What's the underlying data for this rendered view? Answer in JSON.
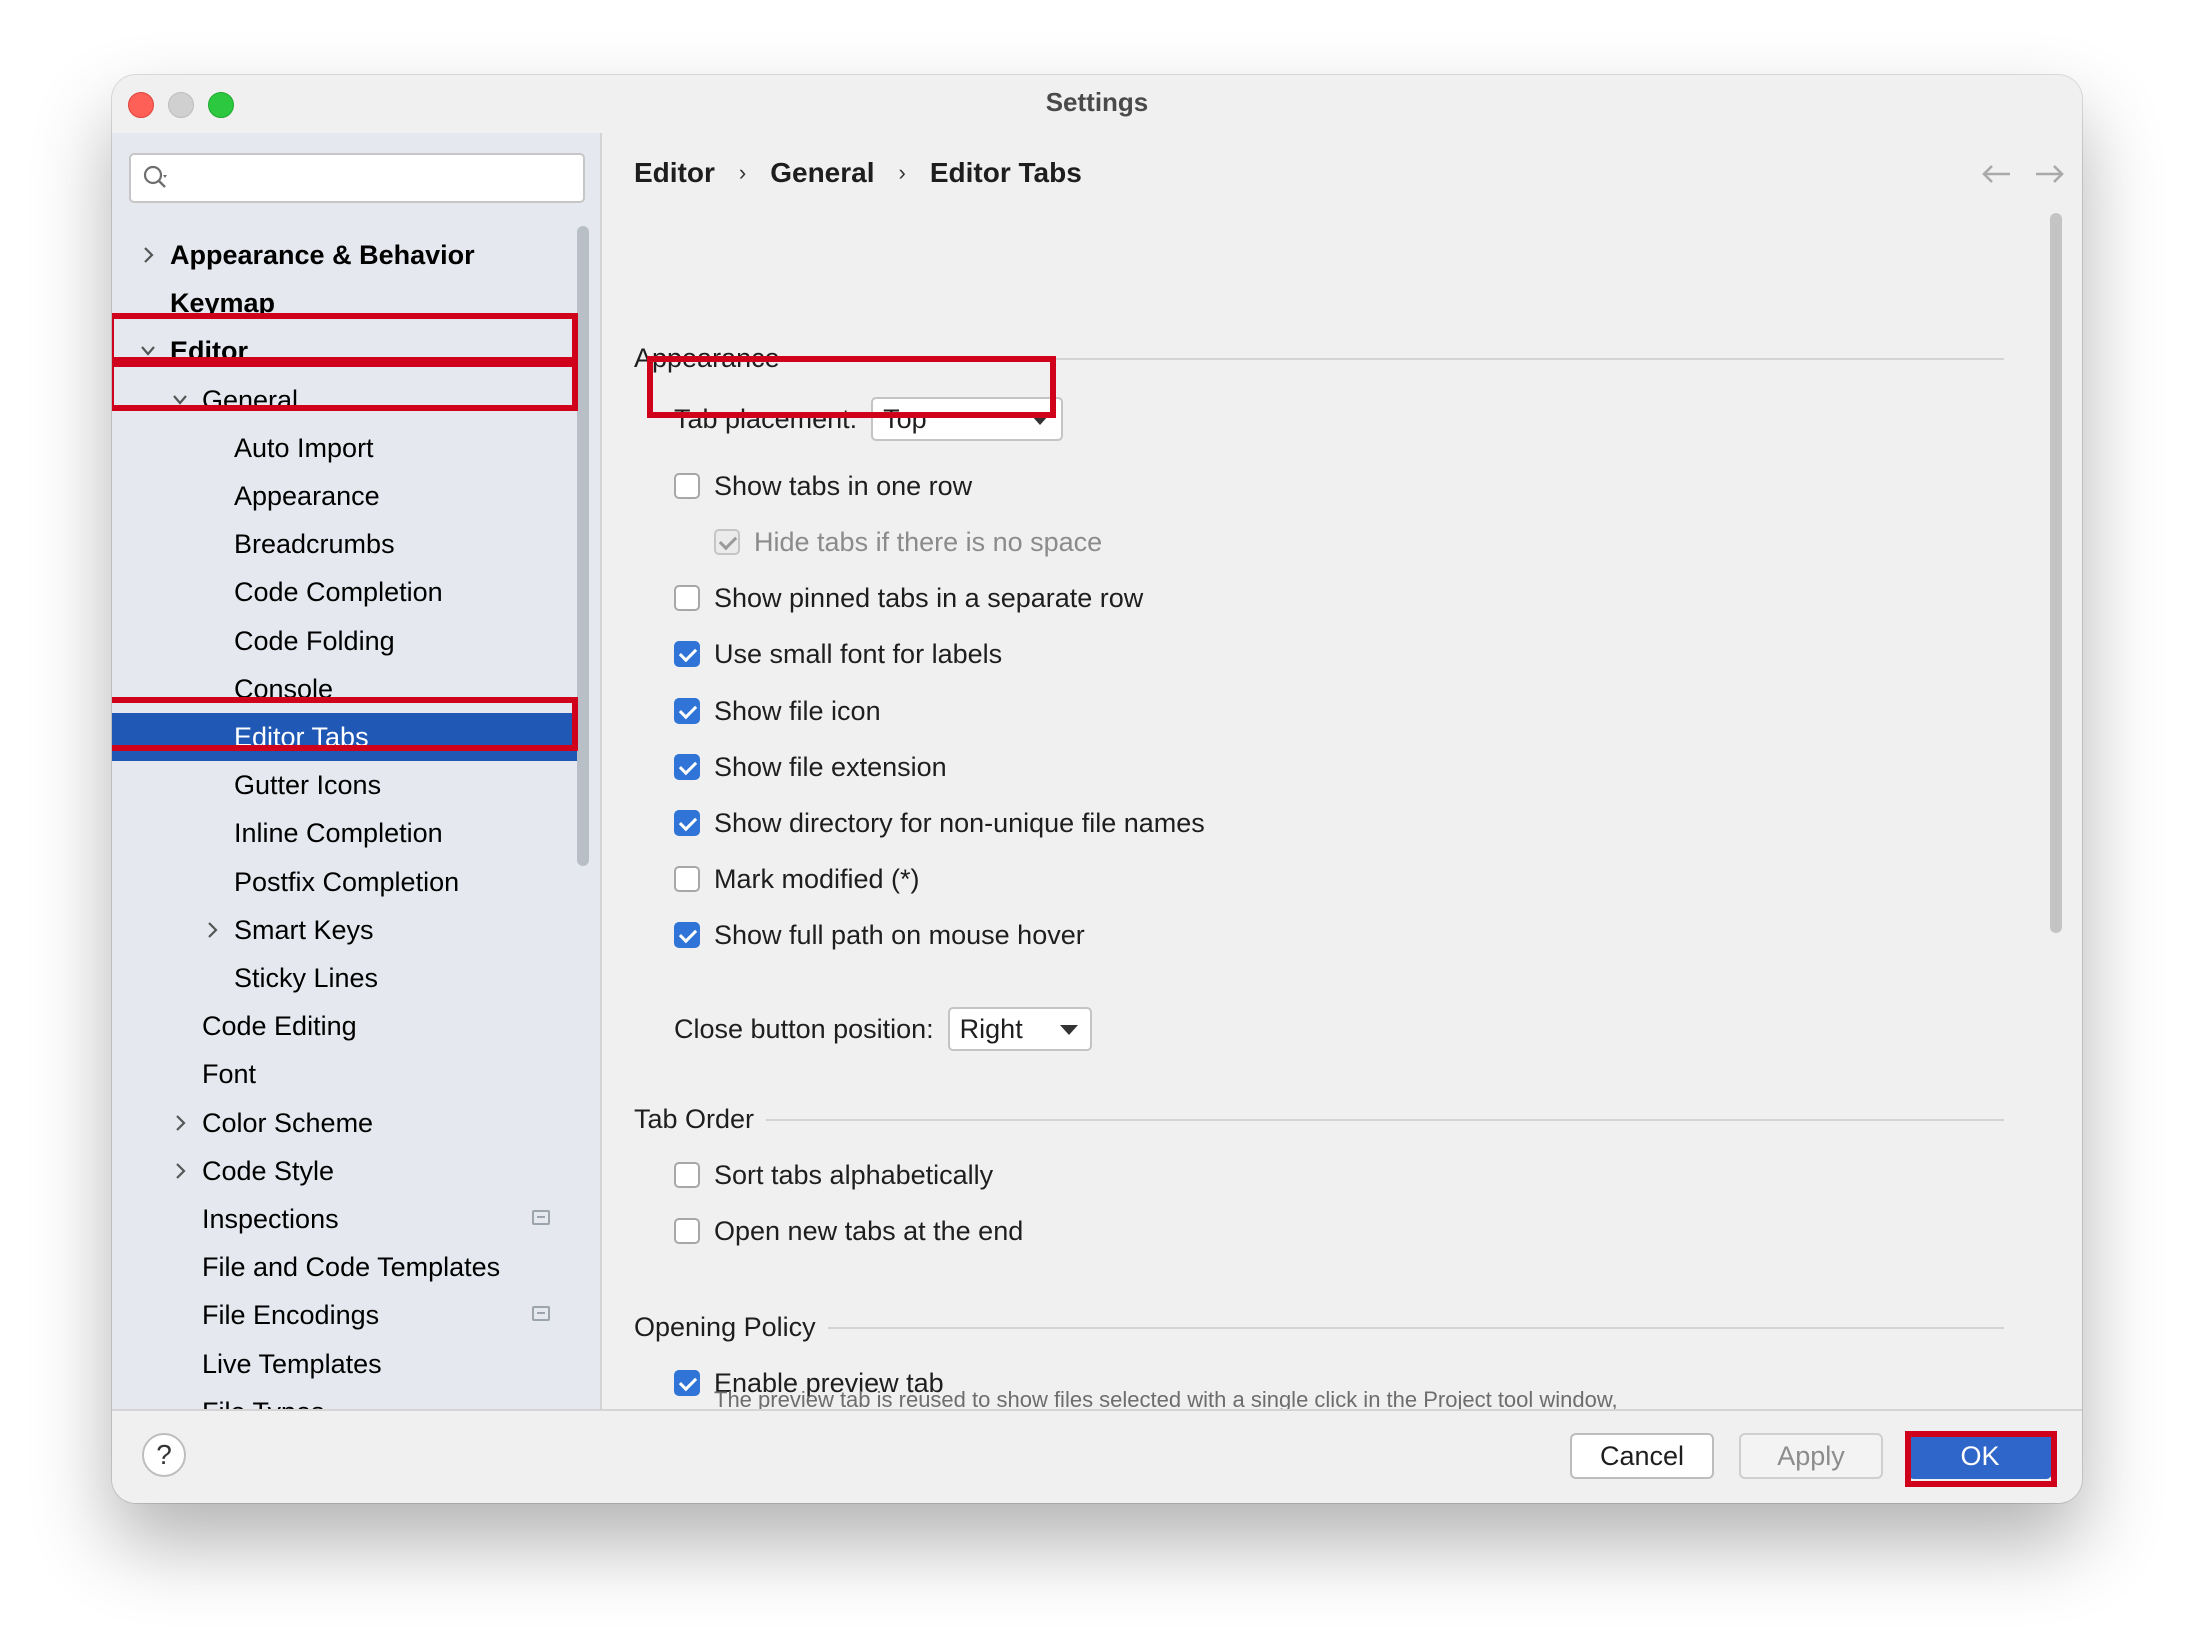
{
  "window": {
    "title": "Settings"
  },
  "search": {
    "placeholder": ""
  },
  "sidebar": {
    "items": [
      {
        "label": "Appearance & Behavior",
        "level": 0,
        "chevron": "right",
        "bold": true
      },
      {
        "label": "Keymap",
        "level": 0,
        "chevron": "none",
        "bold": true
      },
      {
        "label": "Editor",
        "level": 0,
        "chevron": "down",
        "bold": true
      },
      {
        "label": "General",
        "level": 1,
        "chevron": "down"
      },
      {
        "label": "Auto Import",
        "level": 2
      },
      {
        "label": "Appearance",
        "level": 2
      },
      {
        "label": "Breadcrumbs",
        "level": 2
      },
      {
        "label": "Code Completion",
        "level": 2
      },
      {
        "label": "Code Folding",
        "level": 2
      },
      {
        "label": "Console",
        "level": 2
      },
      {
        "label": "Editor Tabs",
        "level": 2,
        "selected": true
      },
      {
        "label": "Gutter Icons",
        "level": 2
      },
      {
        "label": "Inline Completion",
        "level": 2
      },
      {
        "label": "Postfix Completion",
        "level": 2
      },
      {
        "label": "Smart Keys",
        "level": 2,
        "chevron": "right"
      },
      {
        "label": "Sticky Lines",
        "level": 2
      },
      {
        "label": "Code Editing",
        "level": 1
      },
      {
        "label": "Font",
        "level": 1
      },
      {
        "label": "Color Scheme",
        "level": 1,
        "chevron": "right"
      },
      {
        "label": "Code Style",
        "level": 1,
        "chevron": "right"
      },
      {
        "label": "Inspections",
        "level": 1,
        "side_icon": "settings-profile-icon"
      },
      {
        "label": "File and Code Templates",
        "level": 1
      },
      {
        "label": "File Encodings",
        "level": 1,
        "side_icon": "settings-profile-icon"
      },
      {
        "label": "Live Templates",
        "level": 1
      },
      {
        "label": "File Types",
        "level": 1
      }
    ]
  },
  "breadcrumb": {
    "items": [
      "Editor",
      "General",
      "Editor Tabs"
    ],
    "separator": "›"
  },
  "appearance": {
    "heading": "Appearance",
    "tab_placement_label": "Tab placement:",
    "tab_placement_value": "Top",
    "options": [
      {
        "label": "Show tabs in one row",
        "checked": false
      },
      {
        "label": "Hide tabs if there is no space",
        "checked": true,
        "disabled": true
      },
      {
        "label": "Show pinned tabs in a separate row",
        "checked": false
      },
      {
        "label": "Use small font for labels",
        "checked": true
      },
      {
        "label": "Show file icon",
        "checked": true
      },
      {
        "label": "Show file extension",
        "checked": true
      },
      {
        "label": "Show directory for non-unique file names",
        "checked": true
      },
      {
        "label": "Mark modified (*)",
        "checked": false
      },
      {
        "label": "Show full path on mouse hover",
        "checked": true
      }
    ],
    "close_button_label": "Close button position:",
    "close_button_value": "Right"
  },
  "tab_order": {
    "heading": "Tab Order",
    "options": [
      {
        "label": "Sort tabs alphabetically",
        "checked": false
      },
      {
        "label": "Open new tabs at the end",
        "checked": false
      }
    ]
  },
  "opening_policy": {
    "heading": "Opening Policy",
    "options": [
      {
        "label": "Enable preview tab",
        "checked": true
      }
    ],
    "description": "The preview tab is reused to show files selected with a single click in the Project tool window, and files opened during debugging."
  },
  "footer": {
    "help": "?",
    "cancel": "Cancel",
    "apply": "Apply",
    "ok": "OK"
  },
  "colors": {
    "accent": "#2f74d6",
    "selection": "#2058b5",
    "highlight": "#d0021b"
  }
}
